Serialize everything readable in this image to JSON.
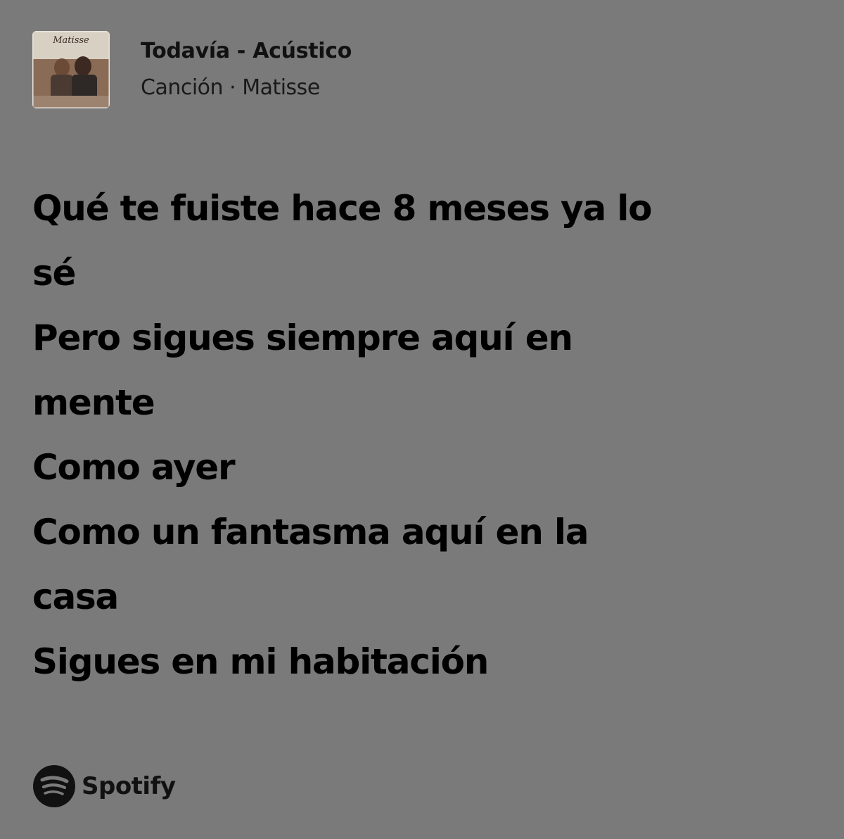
{
  "track": {
    "title": "Todavía - Acústico",
    "type": "Canción",
    "separator": "·",
    "artist": "Matisse",
    "album_logo_text": "Matisse"
  },
  "lyrics": [
    "Qué te fuiste hace 8 meses ya lo",
    "sé",
    "Pero sigues siempre aquí en",
    "mente",
    "Como ayer",
    "Como un fantasma aquí en la",
    "casa",
    "Sigues en mi habitación"
  ],
  "brand": {
    "name": "Spotify",
    "icon": "spotify-icon"
  },
  "colors": {
    "background": "#7a7a7a",
    "text": "#000000"
  }
}
